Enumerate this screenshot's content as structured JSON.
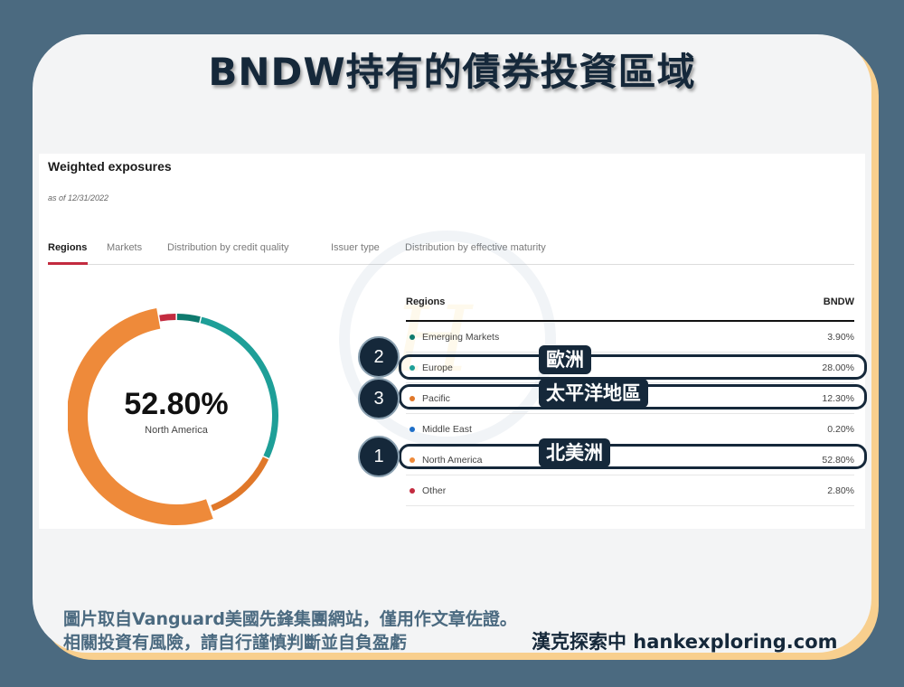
{
  "title": "BNDW持有的債券投資區域",
  "panel": {
    "heading": "Weighted exposures",
    "as_of": "as of 12/31/2022",
    "tabs": [
      {
        "label": "Regions",
        "active": true
      },
      {
        "label": "Markets",
        "active": false
      },
      {
        "label": "Distribution by credit quality",
        "active": false
      },
      {
        "label": "Issuer type",
        "active": false
      },
      {
        "label": "Distribution by effective maturity",
        "active": false
      }
    ]
  },
  "donut": {
    "center_value": "52.80%",
    "center_label": "North America"
  },
  "table": {
    "col_region": "Regions",
    "col_fund": "BNDW",
    "rows": [
      {
        "name": "Emerging Markets",
        "value": "3.90%",
        "color": "#0e7a6e"
      },
      {
        "name": "Europe",
        "value": "28.00%",
        "color": "#1e9f98"
      },
      {
        "name": "Pacific",
        "value": "12.30%",
        "color": "#e0782a"
      },
      {
        "name": "Middle East",
        "value": "0.20%",
        "color": "#1f6fc8"
      },
      {
        "name": "North America",
        "value": "52.80%",
        "color": "#ee8a3a"
      },
      {
        "name": "Other",
        "value": "2.80%",
        "color": "#c32b3f"
      }
    ]
  },
  "highlights": [
    {
      "rank": "1",
      "label": "北美洲",
      "row": "North America"
    },
    {
      "rank": "2",
      "label": "歐洲",
      "row": "Europe"
    },
    {
      "rank": "3",
      "label": "太平洋地區",
      "row": "Pacific"
    }
  ],
  "footer": {
    "line1": "圖片取自Vanguard美國先鋒集團網站，僅用作文章佐證。",
    "line2": "相關投資有風險，請自行謹慎判斷並自負盈虧",
    "brand": "漢克探索中 hankexploring.com"
  },
  "chart_data": {
    "type": "pie",
    "title": "Regions",
    "categories": [
      "Other",
      "Emerging Markets",
      "Europe",
      "Pacific",
      "Middle East",
      "North America"
    ],
    "values": [
      2.8,
      3.9,
      28.0,
      12.3,
      0.2,
      52.8
    ],
    "colors": [
      "#c32b3f",
      "#0e7a6e",
      "#1e9f98",
      "#e0782a",
      "#9aa4b0",
      "#ee8a3a"
    ],
    "selected": "North America",
    "center_text": "52.80%"
  }
}
